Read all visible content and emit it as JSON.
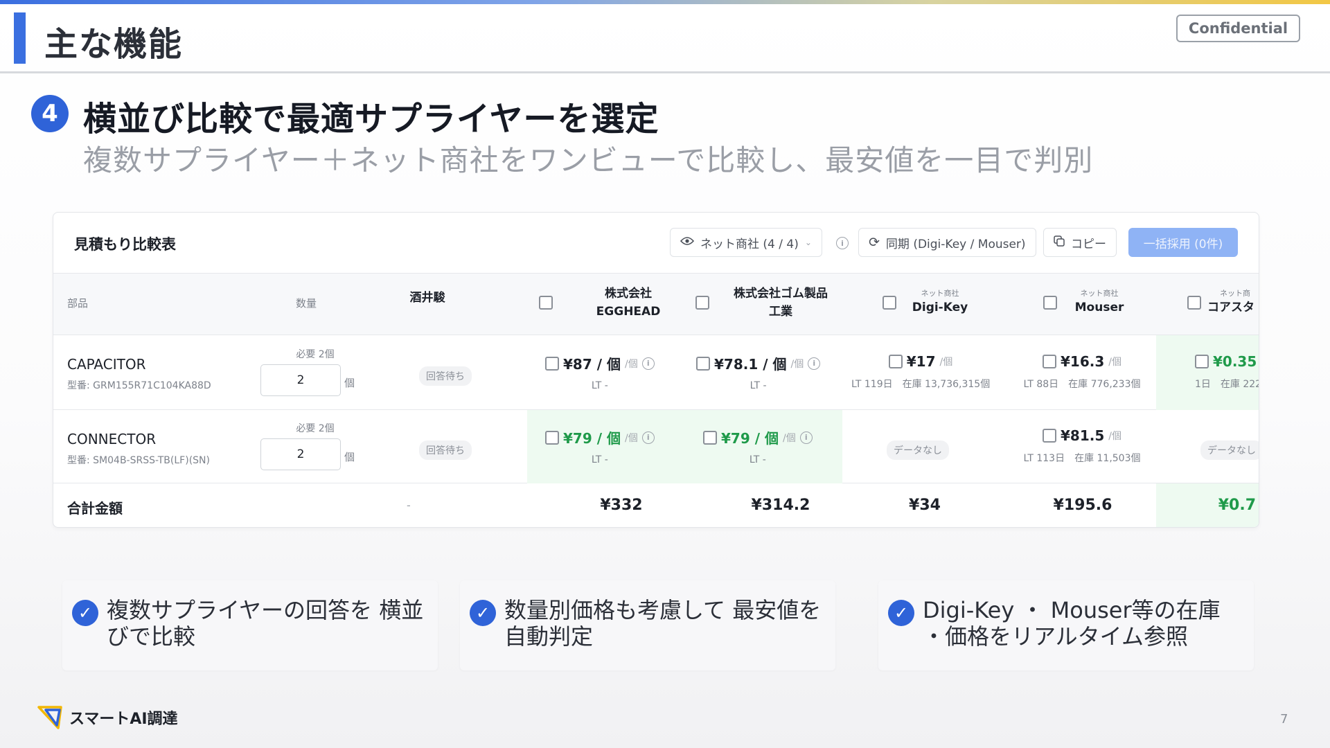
{
  "slide": {
    "title": "主な機能",
    "confidential": "Confidential",
    "number": "4",
    "heading": "横並び比較で最適サプライヤーを選定",
    "subheading": "複数サプライヤー＋ネット商社をワンビューで比較し、最安値を一目で判別",
    "page_number": "7",
    "brand": "スマートAI調達"
  },
  "panel": {
    "title": "見積もり比較表",
    "toolbar": {
      "filter_label": "ネット商社 (4 / 4)",
      "sync_label": "同期 (Digi-Key / Mouser)",
      "copy_label": "コピー",
      "adopt_label": "一括採用 (0件)"
    },
    "columns": {
      "part": "部品",
      "qty": "数量",
      "sakai": "酒井駿",
      "s1": {
        "line1": "株式会社",
        "line2": "EGGHEAD"
      },
      "s2": {
        "line1": "株式会社ゴム製品",
        "line2": "工業"
      },
      "s3": {
        "tag": "ネット商社",
        "name": "Digi-Key"
      },
      "s4": {
        "tag": "ネット商社",
        "name": "Mouser"
      },
      "s5": {
        "tag": "ネット商",
        "name": "コアスタ"
      }
    },
    "rows": [
      {
        "name": "CAPACITOR",
        "part_no": "型番: GRM155R71C104KA88D",
        "need": "必要 2個",
        "qty": "2",
        "unit": "個",
        "sakai": "回答待ち",
        "s1": {
          "price": "¥87 / 個",
          "per": "/個",
          "lt": "LT -"
        },
        "s2": {
          "price": "¥78.1 / 個",
          "per": "/個",
          "lt": "LT -"
        },
        "s3": {
          "price": "¥17",
          "per": "/個",
          "lt": "LT 119日　在庫 13,736,315個"
        },
        "s4": {
          "price": "¥16.3",
          "per": "/個",
          "lt": "LT 88日　在庫 776,233個"
        },
        "s5": {
          "price": "¥0.35",
          "lt": "1日　在庫 222"
        }
      },
      {
        "name": "CONNECTOR",
        "part_no": "型番: SM04B-SRSS-TB(LF)(SN)",
        "need": "必要 2個",
        "qty": "2",
        "unit": "個",
        "sakai": "回答待ち",
        "s1": {
          "price": "¥79 / 個",
          "per": "/個",
          "lt": "LT -"
        },
        "s2": {
          "price": "¥79 / 個",
          "per": "/個",
          "lt": "LT -"
        },
        "s3": {
          "none": "データなし"
        },
        "s4": {
          "price": "¥81.5",
          "per": "/個",
          "lt": "LT 113日　在庫 11,503個"
        },
        "s5": {
          "none": "データなし"
        }
      }
    ],
    "totals": {
      "label": "合計金額",
      "sakai": "-",
      "s1": "¥332",
      "s2": "¥314.2",
      "s3": "¥34",
      "s4": "¥195.6",
      "s5": "¥0.7"
    }
  },
  "cards": [
    {
      "text": "複数サプライヤーの回答を 横並びで比較"
    },
    {
      "text": "数量別価格も考慮して 最安値を自動判定"
    },
    {
      "text": "Digi-Key ・ Mouser等の在庫 ・価格をリアルタイム参照"
    }
  ],
  "colors": {
    "accent": "#2f63d8",
    "best_price": "#1f9a4a",
    "best_bg": "#eefaf1"
  }
}
